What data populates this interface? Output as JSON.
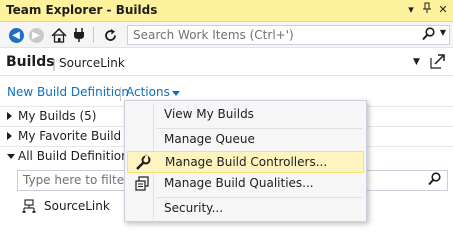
{
  "window": {
    "title": "Team Explorer - Builds",
    "title_bar_color": "#fff29d"
  },
  "toolbar": {
    "icons": [
      "back-icon",
      "forward-icon",
      "home-icon",
      "connect-icon",
      "refresh-icon"
    ],
    "search_placeholder": "Search Work Items (Ctrl+')"
  },
  "header": {
    "title": "Builds",
    "separator": "|",
    "subtitle": "SourceLink"
  },
  "links": {
    "new_build_definition": "New Build Definition",
    "actions": "Actions",
    "link_color": "#0e70c0"
  },
  "tree": {
    "nodes": [
      {
        "label": "My Builds (5)",
        "expanded": false
      },
      {
        "label": "My Favorite Build De",
        "expanded": false
      },
      {
        "label": "All Build Definitions",
        "expanded": true
      }
    ],
    "filter_placeholder": "Type here to filter th",
    "definitions": [
      {
        "label": "SourceLink"
      }
    ]
  },
  "actions_menu": {
    "items": [
      {
        "label": "View My Builds",
        "icon": null,
        "highlighted": false
      },
      {
        "label": "Manage Queue",
        "icon": null,
        "highlighted": false
      },
      {
        "label": "Manage Build Controllers...",
        "icon": "wrench-icon",
        "highlighted": true
      },
      {
        "label": "Manage Build Qualities...",
        "icon": "qualities-icon",
        "highlighted": false
      },
      {
        "label": "Security...",
        "icon": null,
        "highlighted": false
      }
    ],
    "highlight_color": "#fdf4bf"
  }
}
